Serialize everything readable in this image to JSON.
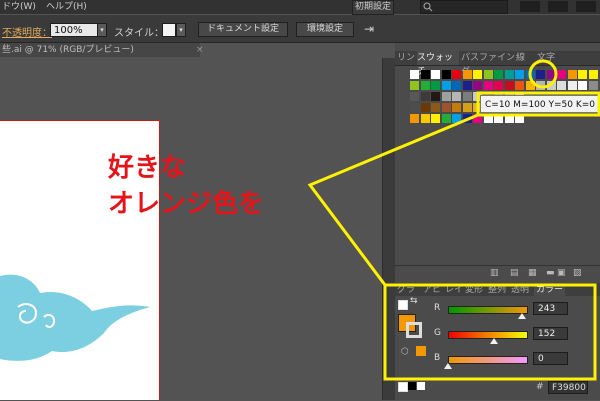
{
  "menubar": {
    "items": [
      "ドウ(W)",
      "ヘルプ(H)"
    ],
    "workspace": "初期設定",
    "workspace_arrow": "▾"
  },
  "controlbar": {
    "opacity_label": "不透明度：",
    "opacity_value": "100%",
    "style_label": "スタイル：",
    "doc_settings": "ドキュメント設定",
    "env_settings": "環境設定"
  },
  "document": {
    "tab_title": "些.ai @ 71% (RGB/プレビュー)",
    "close_glyph": "×"
  },
  "annotation": {
    "line1": "好きな",
    "line2": "オレンジ色を"
  },
  "swatch_panel": {
    "tabs": [
      "リン",
      "スウォッチ",
      "パスファインダ",
      "線",
      "文字"
    ],
    "active_tab": "スウォッチ"
  },
  "tooltip": {
    "text": "C=10 M=100 Y=50 K=0"
  },
  "color_panel": {
    "tabs": [
      "グラ",
      "アピ",
      "レイ",
      "変形",
      "整列",
      "透明",
      "カラー"
    ],
    "active_tab": "カラー",
    "r_label": "R",
    "g_label": "G",
    "b_label": "B",
    "r_value": "243",
    "g_value": "152",
    "b_value": "0",
    "hex_prefix": "#",
    "hex_value": "F39800"
  },
  "colors": {
    "fill": "#F39800",
    "annotation": "#E4141A",
    "highlight": "#FFF200",
    "cloud": "#7CCFE0"
  },
  "icons": [
    "search-icon",
    "minimize-icon",
    "close-icon",
    "swap-icon",
    "cube-warning-icon",
    "new-swatch-icon",
    "delete-icon"
  ]
}
